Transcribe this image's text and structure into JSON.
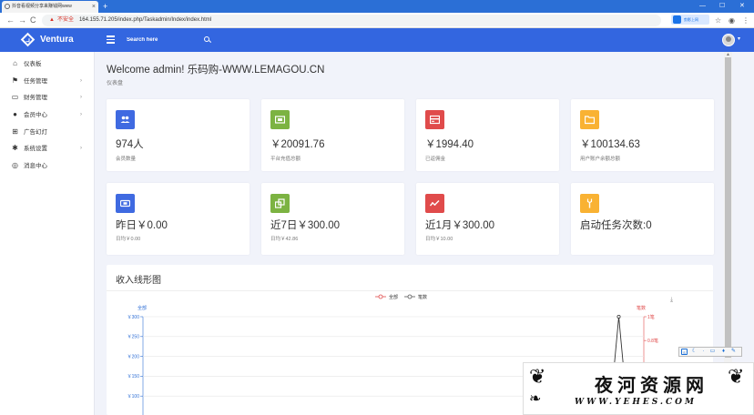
{
  "browser": {
    "tab_title": "抖音看视频分享来赚钱网www",
    "tab_close": "×",
    "new_tab": "+",
    "minimize": "—",
    "maximize": "☐",
    "close": "✕",
    "back": "←",
    "forward": "→",
    "reload": "C",
    "insecure_label": "不安全",
    "url": "164.155.71.205/index.php/Taskadmin/Index/index.html",
    "extension_label": "剪影上网",
    "icons": [
      "translate-icon",
      "star-icon",
      "profile-icon",
      "menu-icon"
    ]
  },
  "header": {
    "logo": "Ventura",
    "search_placeholder": "Search here",
    "brand_color": "#3366e0"
  },
  "sidebar": {
    "items": [
      {
        "label": "仪表板",
        "icon": "home-icon",
        "glyph": "⌂",
        "has_children": false
      },
      {
        "label": "任务管理",
        "icon": "flag-icon",
        "glyph": "⚑",
        "has_children": true
      },
      {
        "label": "财务管理",
        "icon": "drive-icon",
        "glyph": "▭",
        "has_children": true
      },
      {
        "label": "会员中心",
        "icon": "user-icon",
        "glyph": "●",
        "has_children": true
      },
      {
        "label": "广告幻灯",
        "icon": "grid-icon",
        "glyph": "⊞",
        "has_children": false
      },
      {
        "label": "系统设置",
        "icon": "gear-icon",
        "glyph": "✱",
        "has_children": true
      },
      {
        "label": "消息中心",
        "icon": "message-icon",
        "glyph": "◎",
        "has_children": false
      }
    ],
    "chevron": "›"
  },
  "main": {
    "welcome": "Welcome admin! 乐码购-WWW.LEMAGOU.CN",
    "breadcrumb": "仪表盘"
  },
  "stats_row1": [
    {
      "value": "974人",
      "label": "会员数量",
      "color": "#3f6ae1",
      "icon": "users-icon"
    },
    {
      "value": "￥20091.76",
      "label": "平台充值总额",
      "color": "#7cb342",
      "icon": "money-icon"
    },
    {
      "value": "￥1994.40",
      "label": "已返佣金",
      "color": "#e04b4b",
      "icon": "card-icon"
    },
    {
      "value": "￥100134.63",
      "label": "用户账户余额总额",
      "color": "#f9b233",
      "icon": "folder-icon"
    }
  ],
  "stats_row2": [
    {
      "value": "昨日￥0.00",
      "label": "日均￥0.00",
      "color": "#3f6ae1",
      "icon": "cash-icon"
    },
    {
      "value": "近7日￥300.00",
      "label": "日均￥42.86",
      "color": "#7cb342",
      "icon": "copy-icon"
    },
    {
      "value": "近1月￥300.00",
      "label": "日均￥10.00",
      "color": "#e04b4b",
      "icon": "trend-icon"
    },
    {
      "value": "启动任务次数:0",
      "label": "",
      "color": "#f9b233",
      "icon": "tool-icon"
    }
  ],
  "chart": {
    "title": "收入线形图",
    "download_icon": "download-icon"
  },
  "chart_data": {
    "type": "line",
    "title": "",
    "legend": [
      "全部",
      "笔数"
    ],
    "legend_placement": "top-center",
    "y_left_label": "全部",
    "y_right_label": "笔数",
    "y_left_ticks": [
      "￥300",
      "￥250",
      "￥200",
      "￥150",
      "￥100"
    ],
    "y_right_ticks": [
      "1笔",
      "0.8笔"
    ],
    "ylim_left": [
      0,
      300
    ],
    "ylim_right": [
      0,
      1
    ],
    "series": [
      {
        "name": "全部",
        "color": "#333333",
        "peak_value": 300,
        "peak_position": 0.95
      }
    ],
    "grid": true
  },
  "floating_toolbar": {
    "icons": [
      "s-icon",
      "moon-icon",
      "dots-icon",
      "keyboard-icon",
      "shirt-icon",
      "wrench-icon"
    ]
  },
  "watermark": {
    "cn": "夜河资源网",
    "en": "WWW.YEHES.COM"
  }
}
